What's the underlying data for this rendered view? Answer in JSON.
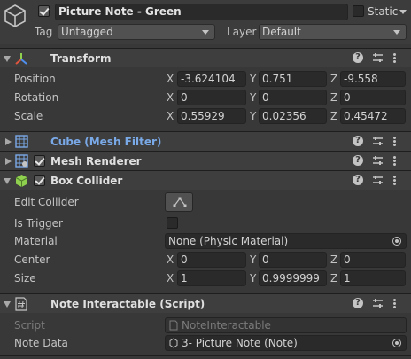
{
  "header": {
    "active": true,
    "object_name": "Picture Note - Green",
    "static_label": "Static",
    "tag_label": "Tag",
    "tag_value": "Untagged",
    "layer_label": "Layer",
    "layer_value": "Default"
  },
  "transform": {
    "title": "Transform",
    "rows": [
      {
        "label": "Position",
        "x": "-3.624104",
        "y": "0.751",
        "z": "-9.558"
      },
      {
        "label": "Rotation",
        "x": "0",
        "y": "0",
        "z": "0"
      },
      {
        "label": "Scale",
        "x": "0.55929",
        "y": "0.02356",
        "z": "0.45472"
      }
    ]
  },
  "axes": {
    "x": "X",
    "y": "Y",
    "z": "Z"
  },
  "mesh_filter": {
    "title": "Cube (Mesh Filter)"
  },
  "mesh_renderer": {
    "title": "Mesh Renderer",
    "enabled": true
  },
  "box_collider": {
    "title": "Box Collider",
    "enabled": true,
    "edit_collider_label": "Edit Collider",
    "is_trigger_label": "Is Trigger",
    "is_trigger": false,
    "material_label": "Material",
    "material_value": "None (Physic Material)",
    "center_label": "Center",
    "center": {
      "x": "0",
      "y": "0",
      "z": "0"
    },
    "size_label": "Size",
    "size": {
      "x": "1",
      "y": "0.9999999",
      "z": "1"
    }
  },
  "note_interactable": {
    "title": "Note Interactable (Script)",
    "script_label": "Script",
    "script_value": "NoteInteractable",
    "note_data_label": "Note Data",
    "note_data_value": "3- Picture Note (Note)"
  },
  "icons": {
    "gameobject": "cube-outline-icon",
    "transform": "transform-axes-icon",
    "mesh_filter": "mesh-grid-icon",
    "mesh_renderer": "mesh-renderer-icon",
    "box_collider": "green-cube-icon",
    "script": "script-hash-icon"
  },
  "colors": {
    "background": "#383838",
    "field": "#2a2a2a",
    "component_link": "#7aa9e8",
    "collider_icon": "#8fd14f"
  }
}
